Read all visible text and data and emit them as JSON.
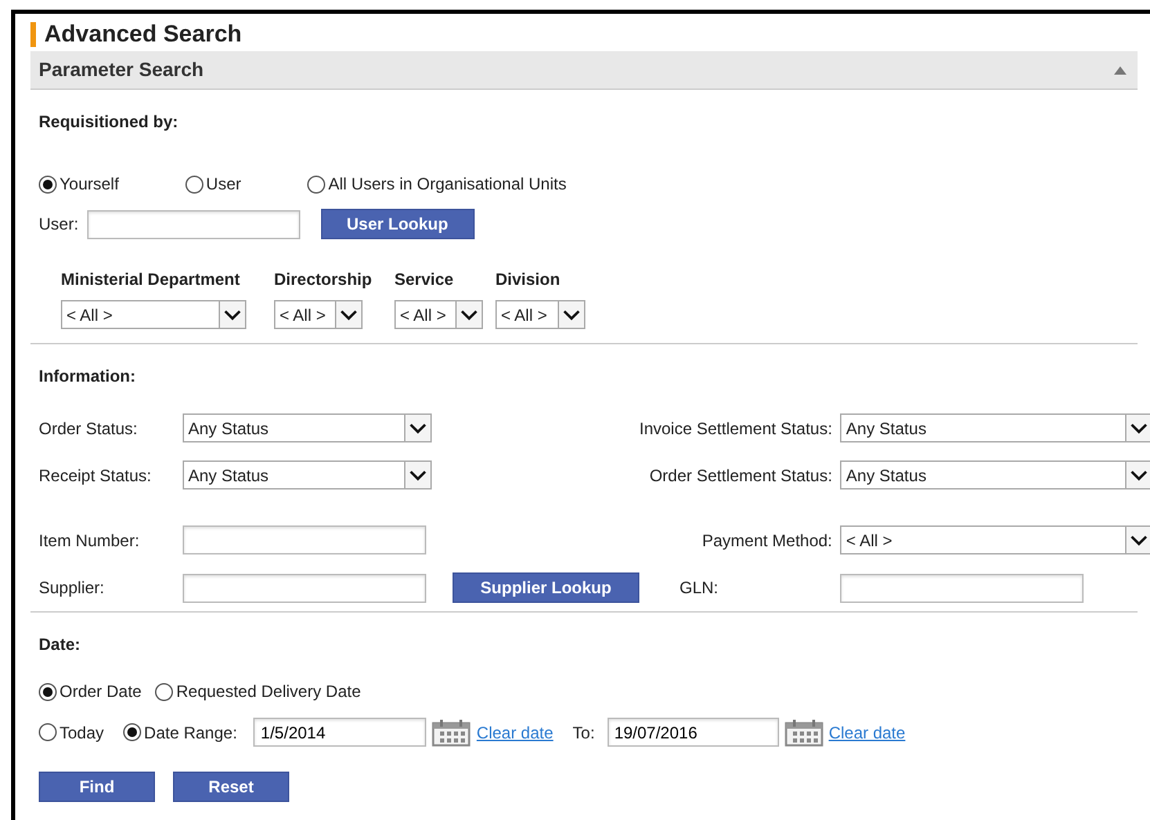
{
  "title": "Advanced Search",
  "panel": {
    "title": "Parameter Search",
    "expanded": true
  },
  "requisitioned_by": {
    "heading": "Requisitioned by:",
    "options": [
      {
        "label": "Yourself",
        "selected": true
      },
      {
        "label": "User",
        "selected": false
      },
      {
        "label": "All Users in Organisational Units",
        "selected": false
      }
    ],
    "user_label": "User:",
    "lookup_button": "User Lookup",
    "org_filters": [
      {
        "label": "Ministerial Department",
        "value": "< All >"
      },
      {
        "label": "Directorship",
        "value": "< All >"
      },
      {
        "label": "Service",
        "value": "< All >"
      },
      {
        "label": "Division",
        "value": "< All >"
      }
    ]
  },
  "information": {
    "heading": "Information:",
    "rows": [
      {
        "left": {
          "kind": "select",
          "label": "Order Status:",
          "value": "Any Status"
        },
        "right": {
          "kind": "select",
          "label": "Invoice Settlement Status:",
          "value": "Any Status"
        }
      },
      {
        "left": {
          "kind": "select",
          "label": "Receipt Status:",
          "value": "Any Status"
        },
        "right": {
          "kind": "select",
          "label": "Order Settlement Status:",
          "value": "Any Status"
        }
      },
      {
        "left": {
          "kind": "text",
          "label": "Item Number:"
        },
        "right": {
          "kind": "select",
          "label": "Payment Method:",
          "value": "< All >"
        }
      },
      {
        "left": {
          "kind": "text",
          "label": "Supplier:"
        },
        "button": "Supplier Lookup",
        "right": {
          "kind": "text",
          "label": "GLN:"
        }
      }
    ]
  },
  "date": {
    "heading": "Date:",
    "options": [
      {
        "label": "Order Date",
        "selected": true
      },
      {
        "label": "Requested Delivery Date",
        "selected": false
      }
    ],
    "range_options": [
      {
        "label": "Today",
        "selected": false
      },
      {
        "label": "Date Range:",
        "selected": true
      }
    ],
    "from": {
      "value": "1/5/2014",
      "clear": "Clear date"
    },
    "to": {
      "label": "To:",
      "value": "19/07/2016",
      "clear": "Clear date"
    }
  },
  "buttons": [
    "Find",
    "Reset"
  ]
}
